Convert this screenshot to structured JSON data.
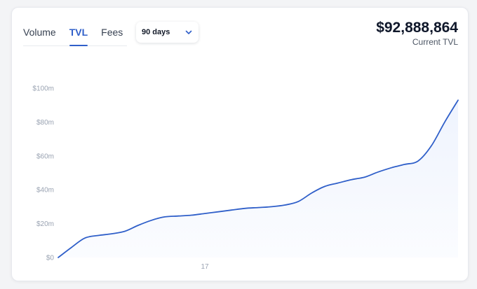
{
  "tabs": [
    {
      "label": "Volume",
      "active": false
    },
    {
      "label": "TVL",
      "active": true
    },
    {
      "label": "Fees",
      "active": false
    }
  ],
  "range_select": {
    "label": "90 days",
    "icon": "chevron-down-icon"
  },
  "stat": {
    "value": "$92,888,864",
    "label": "Current TVL"
  },
  "colors": {
    "accent": "#2f5fc9",
    "line": "#2f5fc9",
    "fill": "#eef3fe"
  },
  "chart_data": {
    "type": "area",
    "x_tick_labels": [
      "17"
    ],
    "y_tick_labels": [
      "$0",
      "$20m",
      "$40m",
      "$60m",
      "$80m",
      "$100m"
    ],
    "y_ticks": [
      0,
      20,
      40,
      60,
      80,
      100
    ],
    "ylim": [
      0,
      100
    ],
    "xlim": [
      0,
      90
    ],
    "grid": false,
    "x_tick_positions": [
      33
    ],
    "series": [
      {
        "x": [
          0,
          3,
          6,
          9,
          12,
          15,
          18,
          21,
          24,
          27,
          30,
          33,
          36,
          39,
          42,
          45,
          48,
          51,
          54,
          57,
          60,
          63,
          66,
          69,
          72,
          75,
          78,
          81,
          84,
          87,
          90
        ],
        "values": [
          0,
          6,
          11.5,
          13,
          14,
          15.5,
          19,
          22,
          24,
          24.5,
          25,
          26,
          27,
          28,
          29,
          29.5,
          30,
          31,
          33,
          38,
          42,
          44,
          46,
          47.5,
          50.5,
          53,
          55,
          57,
          66,
          80,
          92.9
        ]
      }
    ]
  }
}
